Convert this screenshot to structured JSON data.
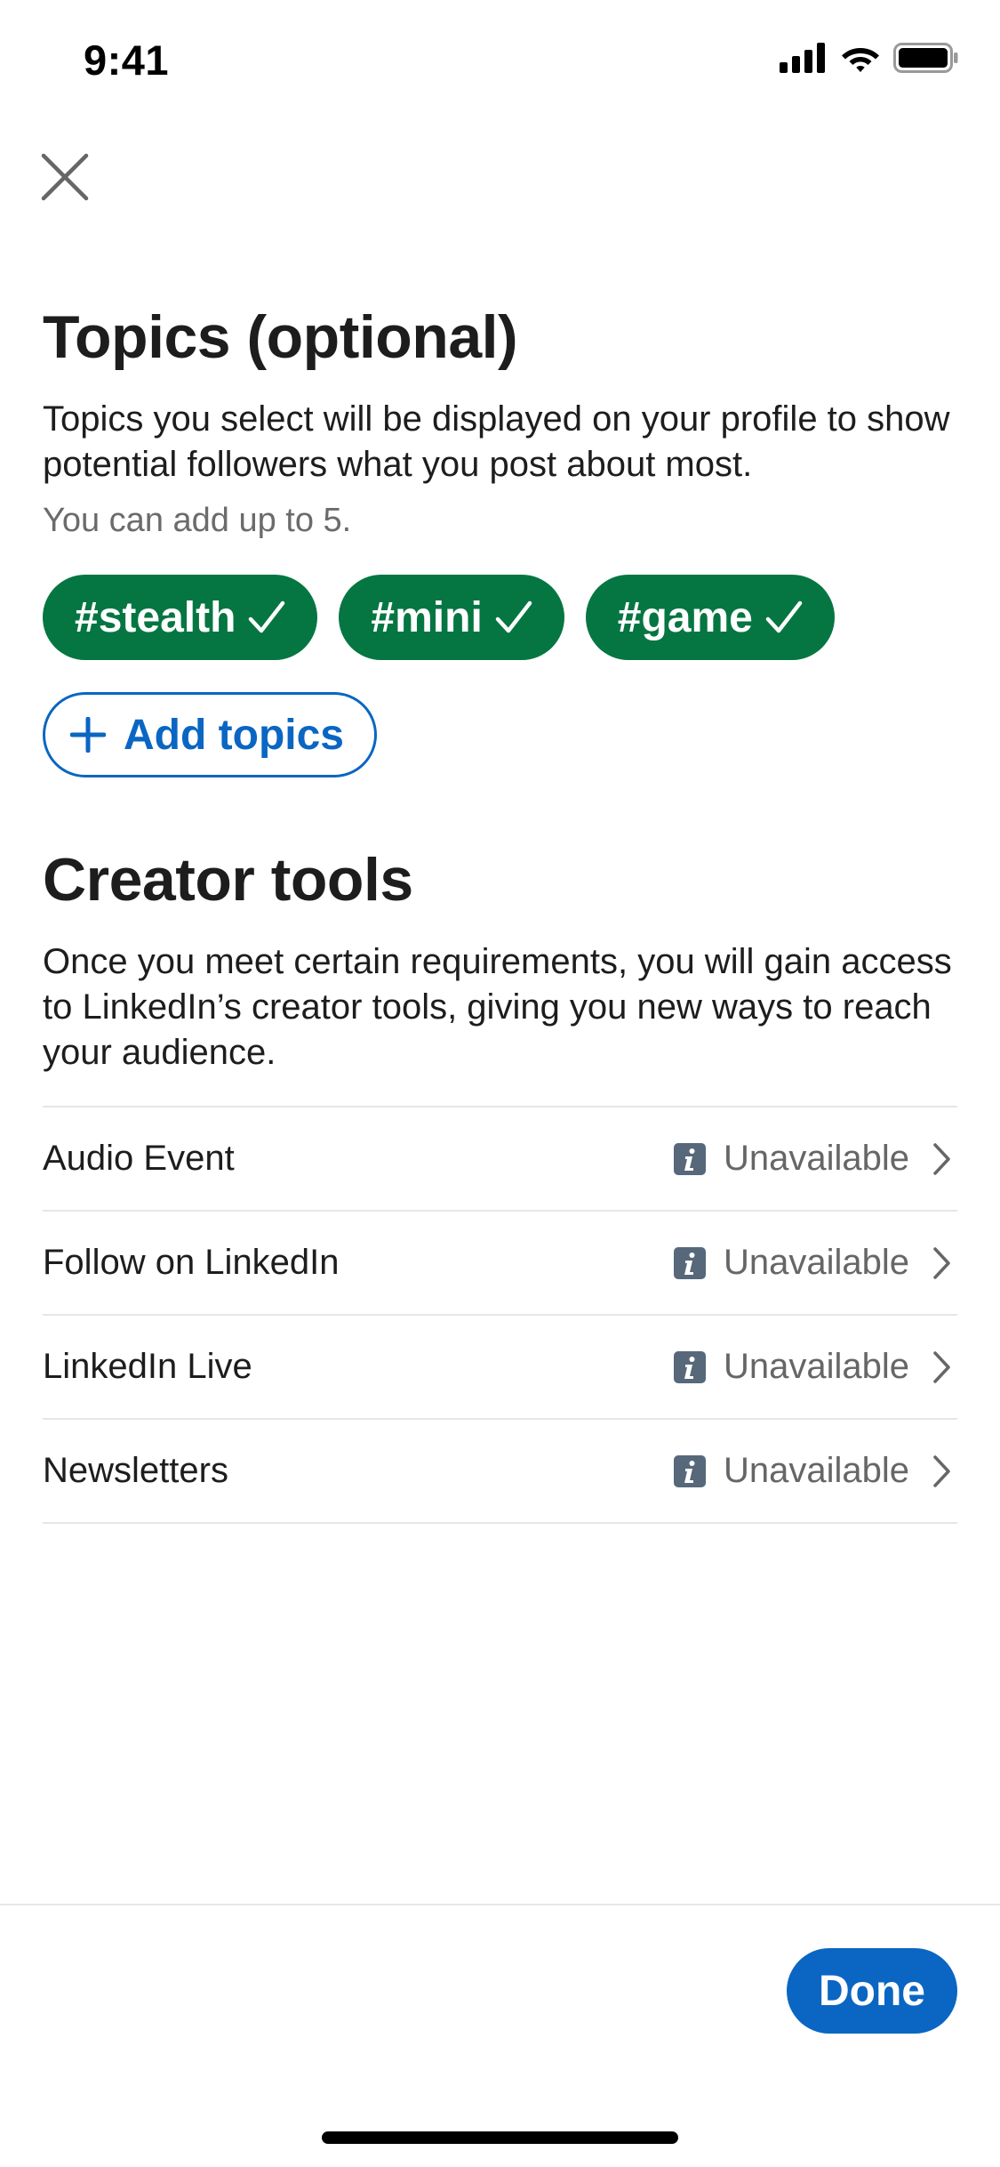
{
  "status_bar": {
    "time": "9:41"
  },
  "icons": {
    "close": "close-icon",
    "signal": "cellular-signal-icon",
    "wifi": "wifi-icon",
    "battery": "battery-icon",
    "check": "checkmark-icon",
    "plus": "plus-icon",
    "info": "info-icon",
    "chevron": "chevron-right-icon"
  },
  "colors": {
    "chip_green": "#057642",
    "brand_blue": "#0a66c2",
    "text_dark": "#1d1d1d",
    "text_muted": "#666666"
  },
  "topics": {
    "title": "Topics (optional)",
    "description": "Topics you select will be displayed on your profile to show potential followers what you post about most.",
    "limit_note": "You can add up to 5.",
    "selected": [
      {
        "label": "#stealth"
      },
      {
        "label": "#mini"
      },
      {
        "label": "#game"
      }
    ],
    "add_label": "Add topics"
  },
  "creator_tools": {
    "title": "Creator tools",
    "description": "Once you meet certain requirements, you will gain access to LinkedIn’s creator tools, giving you new ways to reach your audience.",
    "items": [
      {
        "name": "Audio Event",
        "status": "Unavailable"
      },
      {
        "name": "Follow on LinkedIn",
        "status": "Unavailable"
      },
      {
        "name": "LinkedIn Live",
        "status": "Unavailable"
      },
      {
        "name": "Newsletters",
        "status": "Unavailable"
      }
    ]
  },
  "footer": {
    "done_label": "Done"
  }
}
